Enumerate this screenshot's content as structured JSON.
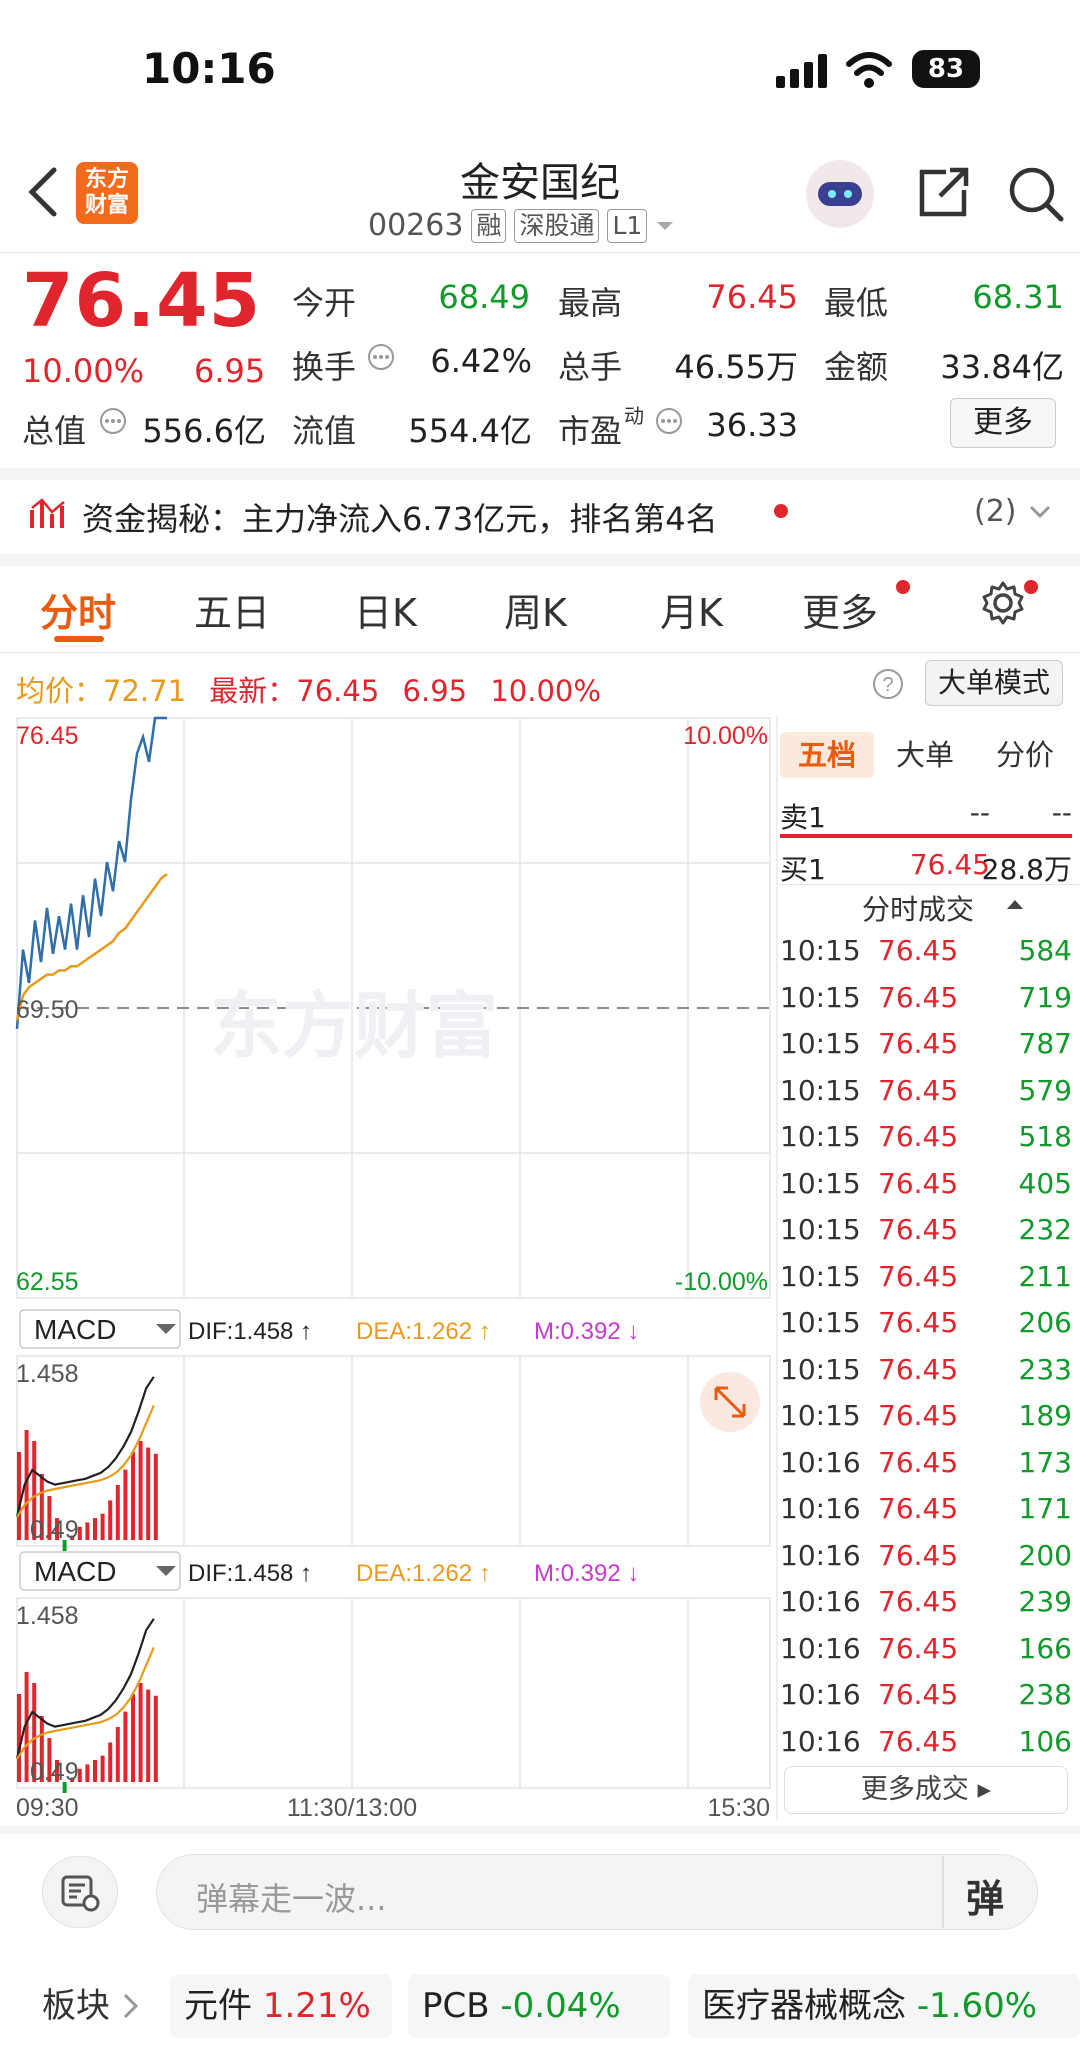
{
  "status_bar": {
    "time": "10:16",
    "battery": "83"
  },
  "header": {
    "title": "金安国纪",
    "code": "00263",
    "tags": [
      "融",
      "深股通",
      "L1"
    ],
    "logo_text": [
      "东方",
      "财富"
    ]
  },
  "quote": {
    "price": "76.45",
    "change_pct": "10.00%",
    "change": "6.95",
    "items": [
      {
        "label": "今开",
        "value": "68.49",
        "color": "green"
      },
      {
        "label": "最高",
        "value": "76.45",
        "color": "red"
      },
      {
        "label": "最低",
        "value": "68.31",
        "color": "green"
      },
      {
        "label": "换手",
        "value": "6.42%",
        "color": "dark"
      },
      {
        "label": "总手",
        "value": "46.55万",
        "color": "dark"
      },
      {
        "label": "金额",
        "value": "33.84亿",
        "color": "dark"
      },
      {
        "label": "总值",
        "value": "556.6亿",
        "color": "dark"
      },
      {
        "label": "流值",
        "value": "554.4亿",
        "color": "dark"
      },
      {
        "label": "市盈",
        "value": "36.33",
        "color": "dark"
      }
    ],
    "pe_sup": "动",
    "more_label": "更多"
  },
  "fund_flow": {
    "text": "资金揭秘：主力净流入6.73亿元，排名第4名",
    "count": "(2)"
  },
  "tabs": [
    "分时",
    "五日",
    "日K",
    "周K",
    "月K",
    "更多"
  ],
  "info_line": {
    "avg_label": "均价：",
    "avg": "72.71",
    "latest_label": "最新：",
    "latest": "76.45",
    "chg": "6.95",
    "pct": "10.00%",
    "big_mode": "大单模式"
  },
  "chart_data": [
    {
      "type": "line",
      "title": "",
      "y_labels": {
        "top": "76.45",
        "mid": "69.50",
        "bottom": "62.55",
        "top_pct": "10.00%",
        "bottom_pct": "-10.00%"
      },
      "x_labels": [
        "09:30",
        "11:30/13:00",
        "15:30"
      ],
      "ylim": [
        62.55,
        76.45
      ],
      "watermark": "东方财富",
      "series": [
        {
          "name": "最新",
          "values": [
            69.0,
            70.9,
            70.1,
            71.6,
            70.6,
            71.9,
            70.8,
            71.7,
            70.9,
            72.0,
            70.9,
            72.2,
            71.2,
            72.6,
            71.7,
            73.0,
            72.3,
            73.5,
            73.0,
            74.5,
            75.6,
            76.0,
            75.4,
            76.45,
            76.45,
            76.45
          ]
        },
        {
          "name": "均价",
          "values": [
            69.2,
            69.8,
            70.0,
            70.1,
            70.2,
            70.3,
            70.3,
            70.4,
            70.4,
            70.5,
            70.5,
            70.6,
            70.7,
            70.8,
            70.9,
            71.0,
            71.1,
            71.3,
            71.4,
            71.6,
            71.8,
            72.0,
            72.2,
            72.4,
            72.6,
            72.71
          ]
        }
      ]
    },
    {
      "type": "line",
      "label": "MACD",
      "dif": "DIF:1.458 ↑",
      "dea": "DEA:1.262 ↑",
      "m": "M:0.392 ↓",
      "y_labels": {
        "top": "1.458",
        "bottom": "0.49"
      },
      "ylim": [
        0.3,
        1.6
      ],
      "series": [
        {
          "name": "DIF",
          "values": [
            0.5,
            0.72,
            0.82,
            0.78,
            0.74,
            0.72,
            0.73,
            0.74,
            0.75,
            0.76,
            0.78,
            0.8,
            0.84,
            0.9,
            0.98,
            1.08,
            1.22,
            1.38,
            1.458
          ]
        },
        {
          "name": "DEA",
          "values": [
            0.5,
            0.58,
            0.63,
            0.66,
            0.68,
            0.69,
            0.7,
            0.71,
            0.72,
            0.73,
            0.74,
            0.75,
            0.77,
            0.8,
            0.85,
            0.92,
            1.02,
            1.14,
            1.262
          ]
        },
        {
          "name": "M",
          "values": [
            0.4,
            0.5,
            0.45,
            0.3,
            0.2,
            0.1,
            -0.05,
            0.02,
            0.06,
            0.08,
            0.1,
            0.12,
            0.18,
            0.25,
            0.32,
            0.4,
            0.45,
            0.42,
            0.392
          ]
        }
      ]
    }
  ],
  "panel": {
    "tabs": [
      "五档",
      "大单",
      "分价"
    ],
    "sell1": {
      "label": "卖1",
      "price": "--",
      "vol": "--"
    },
    "buy1": {
      "label": "买1",
      "price": "76.45",
      "vol": "28.8万"
    },
    "trades_title": "分时成交",
    "trades": [
      {
        "t": "10:15",
        "p": "76.45",
        "v": "584"
      },
      {
        "t": "10:15",
        "p": "76.45",
        "v": "719"
      },
      {
        "t": "10:15",
        "p": "76.45",
        "v": "787"
      },
      {
        "t": "10:15",
        "p": "76.45",
        "v": "579"
      },
      {
        "t": "10:15",
        "p": "76.45",
        "v": "518"
      },
      {
        "t": "10:15",
        "p": "76.45",
        "v": "405"
      },
      {
        "t": "10:15",
        "p": "76.45",
        "v": "232"
      },
      {
        "t": "10:15",
        "p": "76.45",
        "v": "211"
      },
      {
        "t": "10:15",
        "p": "76.45",
        "v": "206"
      },
      {
        "t": "10:15",
        "p": "76.45",
        "v": "233"
      },
      {
        "t": "10:15",
        "p": "76.45",
        "v": "189"
      },
      {
        "t": "10:16",
        "p": "76.45",
        "v": "173"
      },
      {
        "t": "10:16",
        "p": "76.45",
        "v": "171"
      },
      {
        "t": "10:16",
        "p": "76.45",
        "v": "200"
      },
      {
        "t": "10:16",
        "p": "76.45",
        "v": "239"
      },
      {
        "t": "10:16",
        "p": "76.45",
        "v": "166"
      },
      {
        "t": "10:16",
        "p": "76.45",
        "v": "238"
      },
      {
        "t": "10:16",
        "p": "76.45",
        "v": "106"
      }
    ],
    "more_trades": "更多成交"
  },
  "bottom": {
    "comment_placeholder": "弹幕走一波...",
    "danmu_label": "弹",
    "sector_label": "板块",
    "sectors": [
      {
        "name": "元件",
        "pct": "1.21%",
        "color": "red"
      },
      {
        "name": "PCB",
        "pct": "-0.04%",
        "color": "green"
      },
      {
        "name": "医疗器械概念",
        "pct": "-1.60%",
        "color": "green"
      }
    ]
  },
  "colors": {
    "red": "#e0262c",
    "green": "#119a2a",
    "accent": "#e85c12",
    "price_line": "#2f6ea8",
    "avg_line": "#e89a1a"
  }
}
